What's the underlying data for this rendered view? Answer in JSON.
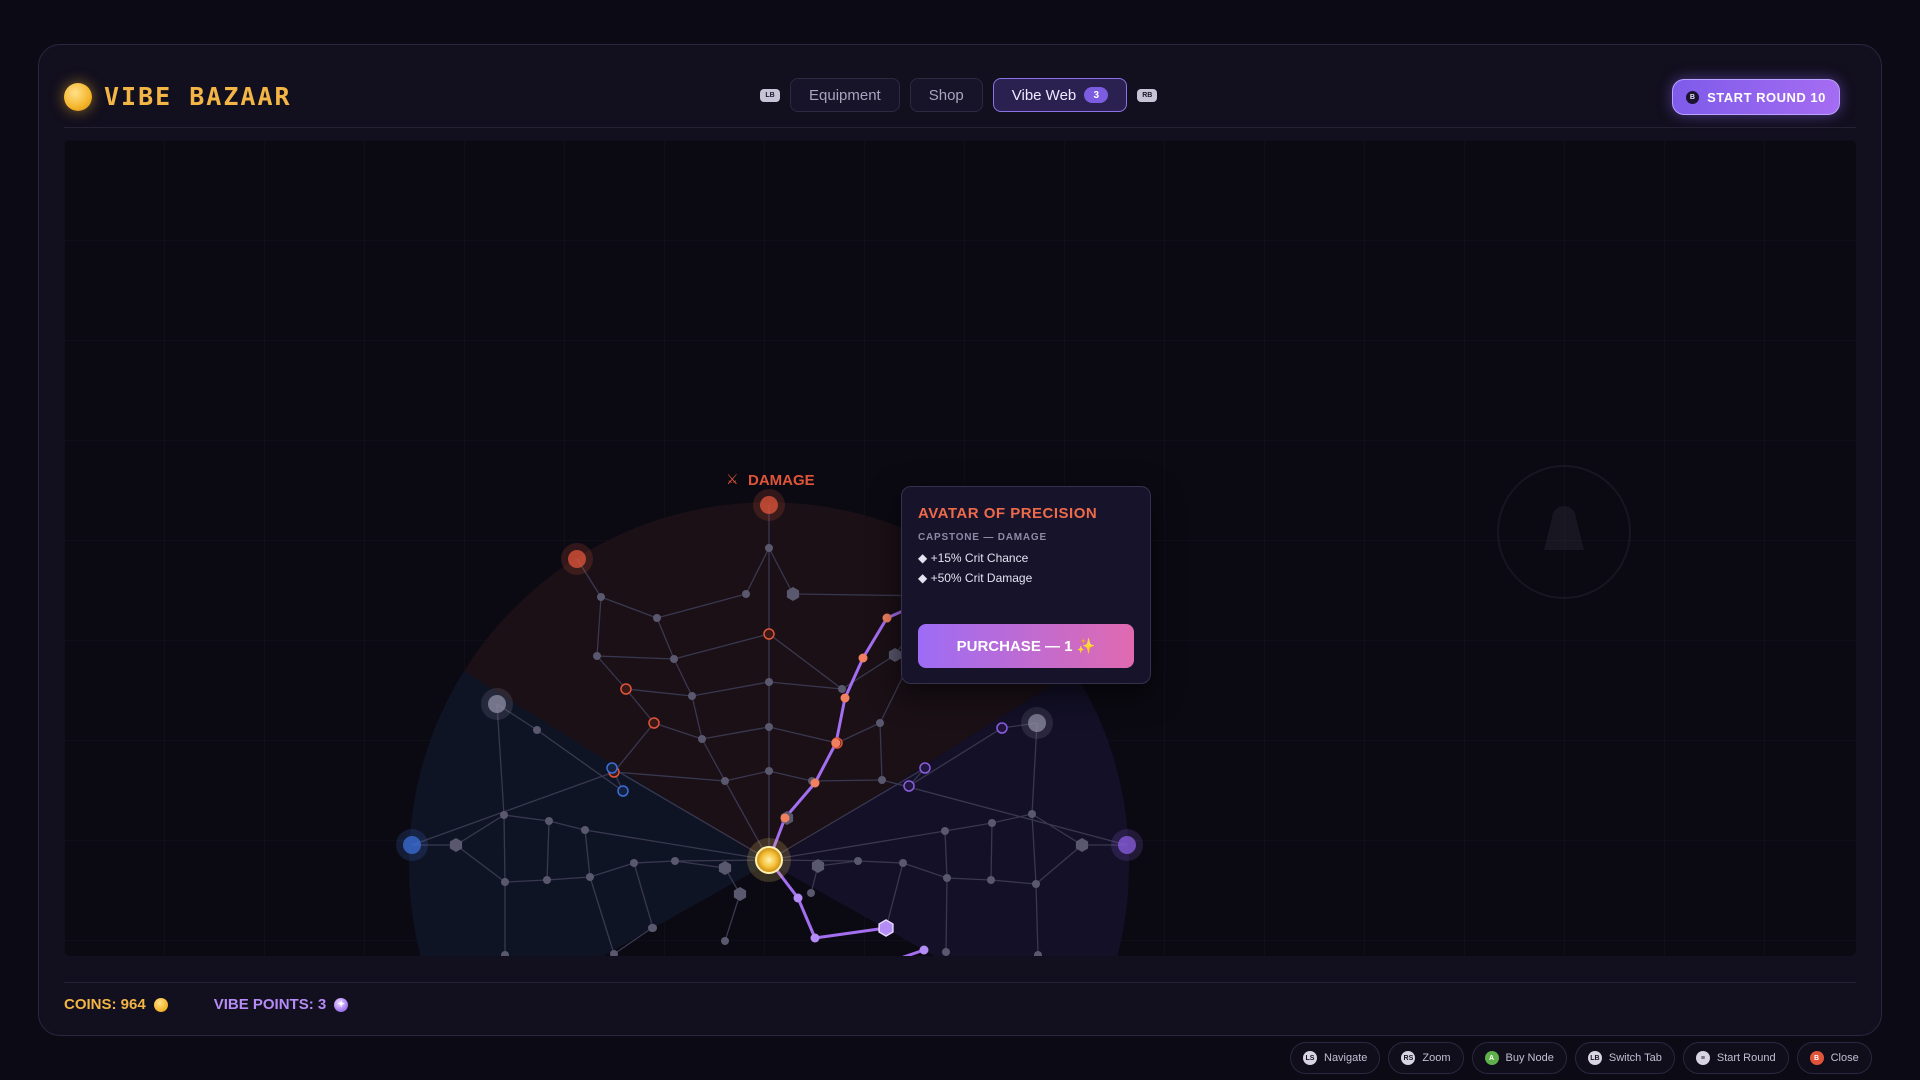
{
  "app": {
    "title": "VIBE BAZAAR"
  },
  "tabs": {
    "left_bumper": "LB",
    "right_bumper": "RB",
    "items": [
      {
        "label": "Equipment",
        "active": false
      },
      {
        "label": "Shop",
        "active": false
      },
      {
        "label": "Vibe Web",
        "active": true,
        "badge": "3"
      }
    ]
  },
  "header": {
    "start_round_label": "START ROUND 10",
    "start_round_glyph": "B"
  },
  "web": {
    "branch_label": "DAMAGE",
    "branch_icon": "crossed-swords-icon",
    "colors": {
      "damage": "#e0553a",
      "defense": "#3c6fd8",
      "utility": "#8a5fe0",
      "path": "#a46ef0",
      "core": "#ffd86a"
    }
  },
  "tooltip": {
    "title": "AVATAR OF PRECISION",
    "subtitle": "CAPSTONE — DAMAGE",
    "stats": [
      "+15% Crit Chance",
      "+50% Crit Damage"
    ],
    "purchase_label": "PURCHASE — 1 ✨"
  },
  "footer": {
    "coins_label": "COINS: 964",
    "vibe_points_label": "VIBE POINTS: 3",
    "vibe_glyph": "✦"
  },
  "hints": [
    {
      "glyph": "LS",
      "label": "Navigate",
      "icon": "left-stick-icon"
    },
    {
      "glyph": "RS",
      "label": "Zoom",
      "icon": "right-stick-icon"
    },
    {
      "glyph": "A",
      "label": "Buy Node",
      "icon": "a-button-icon"
    },
    {
      "glyph": "LB",
      "label": "Switch Tab",
      "icon": "bumper-icon"
    },
    {
      "glyph": "≡",
      "label": "Start Round",
      "icon": "menu-button-icon"
    },
    {
      "glyph": "B",
      "label": "Close",
      "icon": "b-button-icon"
    }
  ]
}
